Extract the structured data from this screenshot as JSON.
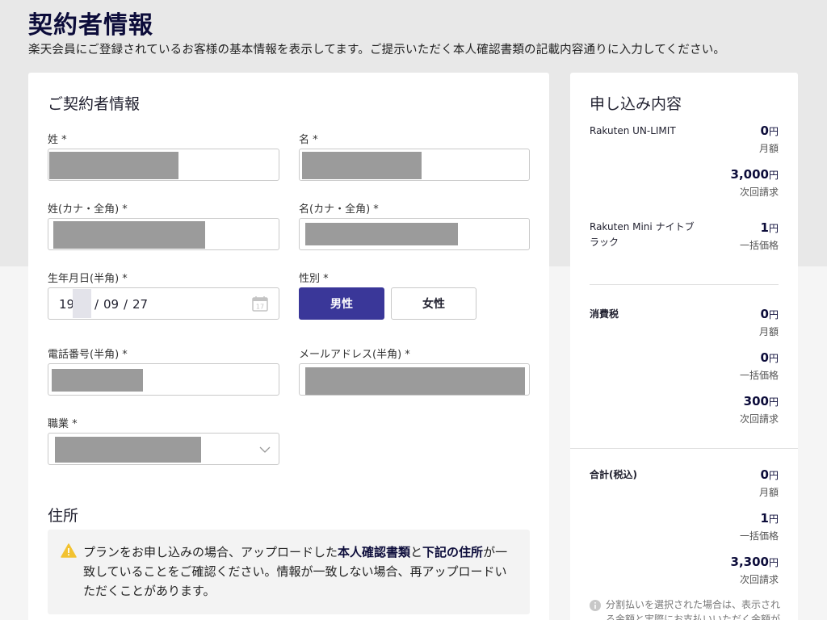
{
  "page": {
    "title": "契約者情報",
    "description": "楽天会員にご登録されているお客様の基本情報を表示してます。ご提示いただく本人確認書類の記載内容通りに入力してください。"
  },
  "form": {
    "section_title": "ご契約者情報",
    "last_name_label": "姓 *",
    "first_name_label": "名 *",
    "last_name_kana_label": "姓(カナ・全角) *",
    "first_name_kana_label": "名(カナ・全角) *",
    "birthdate_label": "生年月日(半角) *",
    "birthdate": {
      "year": "19",
      "month": "09",
      "day": "27",
      "separator": "/"
    },
    "gender_label": "性別 *",
    "gender_male": "男性",
    "gender_female": "女性",
    "gender_selected": "男性",
    "phone_label": "電話番号(半角) *",
    "email_label": "メールアドレス(半角) *",
    "occupation_label": "職業 *"
  },
  "address": {
    "section_title": "住所",
    "notice_part1": "プランをお申し込みの場合、アップロードした",
    "notice_bold1": "本人確認書類",
    "notice_part2": "と",
    "notice_bold2": "下記の住所",
    "notice_part3": "が一致していることをご確認ください。情報が一致しない場合、再アップロードいただくことがあります。"
  },
  "summary": {
    "title": "申し込み内容",
    "items": [
      {
        "name": "Rakuten UN-LIMIT",
        "prices": [
          {
            "amount": "0",
            "unit": "円",
            "note": "月額"
          },
          {
            "amount": "3,000",
            "unit": "円",
            "note": "次回請求"
          }
        ]
      },
      {
        "name": "Rakuten Mini ナイトブラック",
        "prices": [
          {
            "amount": "1",
            "unit": "円",
            "note": "一括価格"
          }
        ]
      }
    ],
    "tax": {
      "name": "消費税",
      "prices": [
        {
          "amount": "0",
          "unit": "円",
          "note": "月額"
        },
        {
          "amount": "0",
          "unit": "円",
          "note": "一括価格"
        },
        {
          "amount": "300",
          "unit": "円",
          "note": "次回請求"
        }
      ]
    },
    "total": {
      "name": "合計(税込)",
      "prices": [
        {
          "amount": "0",
          "unit": "円",
          "note": "月額"
        },
        {
          "amount": "1",
          "unit": "円",
          "note": "一括価格"
        },
        {
          "amount": "3,300",
          "unit": "円",
          "note": "次回請求"
        }
      ]
    },
    "installment_note": "分割払いを選択された場合は、表示される金額と実際にお支払いいただく金額が"
  },
  "colors": {
    "accent": "#3a3799",
    "title": "#0c0c3a",
    "masked": "#9b9b9b",
    "warning": "#f2c230"
  }
}
